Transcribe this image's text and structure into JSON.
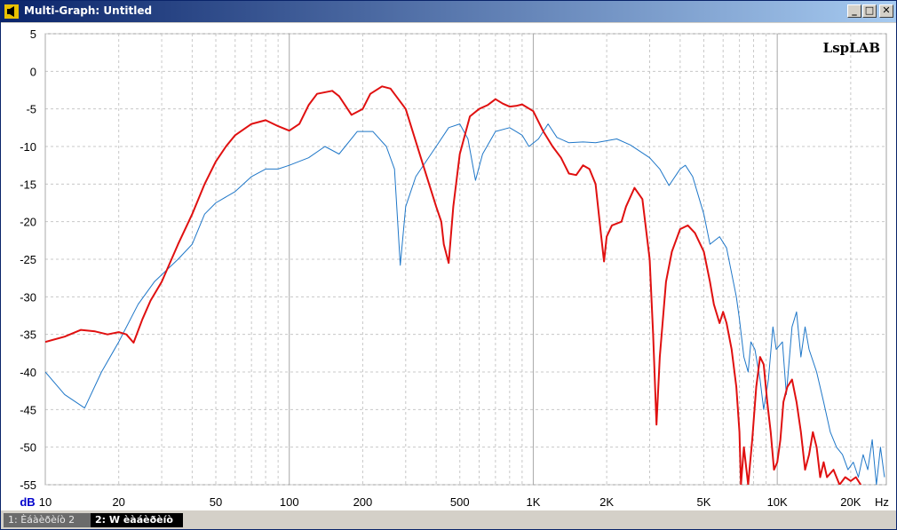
{
  "window": {
    "title": "Multi-Graph: Untitled",
    "buttons": {
      "minimize": "_",
      "maximize": "□",
      "close": "✕"
    }
  },
  "brand": "LspLAB",
  "tabs": [
    {
      "label": "1: Èáàèðèíò 2",
      "active": false
    },
    {
      "label": "2: W èàáèðèíò",
      "active": true
    }
  ],
  "colors": {
    "series1": "#1f77c8",
    "series2": "#e01010",
    "grid": "#c8c8c8",
    "axis_text": "#000000",
    "unit_text": "#0000cc"
  },
  "chart_data": {
    "type": "line",
    "xscale": "log",
    "xlim": [
      10,
      28000
    ],
    "ylim": [
      -55,
      5
    ],
    "ylabel": "dB",
    "xunit": "Hz",
    "x_ticks": [
      {
        "value": 10,
        "label": "10"
      },
      {
        "value": 20,
        "label": "20"
      },
      {
        "value": 50,
        "label": "50"
      },
      {
        "value": 100,
        "label": "100"
      },
      {
        "value": 200,
        "label": "200"
      },
      {
        "value": 500,
        "label": "500"
      },
      {
        "value": 1000,
        "label": "1K"
      },
      {
        "value": 2000,
        "label": "2K"
      },
      {
        "value": 5000,
        "label": "5K"
      },
      {
        "value": 10000,
        "label": "10K"
      },
      {
        "value": 20000,
        "label": "20K"
      }
    ],
    "y_ticks": [
      5,
      0,
      -5,
      -10,
      -15,
      -20,
      -25,
      -30,
      -35,
      -40,
      -45,
      -50,
      -55
    ],
    "grid": true,
    "series": [
      {
        "color_key": "series1",
        "points": [
          [
            10,
            -40
          ],
          [
            12,
            -43
          ],
          [
            14.5,
            -44.8
          ],
          [
            17,
            -40
          ],
          [
            20,
            -36
          ],
          [
            24,
            -31
          ],
          [
            28,
            -28
          ],
          [
            35,
            -25
          ],
          [
            40,
            -23
          ],
          [
            45,
            -19
          ],
          [
            50,
            -17.5
          ],
          [
            60,
            -16
          ],
          [
            70,
            -14
          ],
          [
            80,
            -13
          ],
          [
            90,
            -13
          ],
          [
            100,
            -12.5
          ],
          [
            120,
            -11.5
          ],
          [
            140,
            -10
          ],
          [
            160,
            -11
          ],
          [
            190,
            -8
          ],
          [
            220,
            -8
          ],
          [
            250,
            -10
          ],
          [
            270,
            -13
          ],
          [
            285,
            -25.8
          ],
          [
            300,
            -18
          ],
          [
            330,
            -14
          ],
          [
            400,
            -10
          ],
          [
            450,
            -7.5
          ],
          [
            500,
            -7
          ],
          [
            540,
            -9
          ],
          [
            580,
            -14.5
          ],
          [
            620,
            -11
          ],
          [
            700,
            -8
          ],
          [
            800,
            -7.5
          ],
          [
            850,
            -8
          ],
          [
            900,
            -8.5
          ],
          [
            960,
            -10
          ],
          [
            1050,
            -9
          ],
          [
            1150,
            -7
          ],
          [
            1250,
            -8.8
          ],
          [
            1400,
            -9.5
          ],
          [
            1600,
            -9.4
          ],
          [
            1800,
            -9.5
          ],
          [
            2200,
            -9
          ],
          [
            2500,
            -9.8
          ],
          [
            3000,
            -11.5
          ],
          [
            3300,
            -13
          ],
          [
            3600,
            -15.2
          ],
          [
            4000,
            -13
          ],
          [
            4200,
            -12.5
          ],
          [
            4500,
            -14
          ],
          [
            5000,
            -19
          ],
          [
            5300,
            -23
          ],
          [
            5800,
            -22
          ],
          [
            6200,
            -23.5
          ],
          [
            6800,
            -30
          ],
          [
            7000,
            -33
          ],
          [
            7300,
            -38
          ],
          [
            7600,
            -40
          ],
          [
            7800,
            -36
          ],
          [
            8100,
            -37
          ],
          [
            8500,
            -41
          ],
          [
            8800,
            -45
          ],
          [
            9200,
            -41
          ],
          [
            9600,
            -34
          ],
          [
            9900,
            -37
          ],
          [
            10500,
            -36
          ],
          [
            10900,
            -43
          ],
          [
            11500,
            -34
          ],
          [
            12000,
            -32
          ],
          [
            12500,
            -38
          ],
          [
            13000,
            -34
          ],
          [
            13500,
            -37
          ],
          [
            14500,
            -40
          ],
          [
            15500,
            -44
          ],
          [
            16500,
            -48
          ],
          [
            17500,
            -50
          ],
          [
            18500,
            -51
          ],
          [
            19500,
            -53
          ],
          [
            20500,
            -52
          ],
          [
            21500,
            -54
          ],
          [
            22500,
            -51
          ],
          [
            23500,
            -53
          ],
          [
            24500,
            -49
          ],
          [
            25500,
            -55
          ],
          [
            26500,
            -50
          ],
          [
            27500,
            -54
          ]
        ]
      },
      {
        "color_key": "series2",
        "points": [
          [
            10,
            -36
          ],
          [
            12,
            -35.3
          ],
          [
            14,
            -34.4
          ],
          [
            16,
            -34.6
          ],
          [
            18,
            -35
          ],
          [
            20,
            -34.7
          ],
          [
            21.5,
            -35
          ],
          [
            23,
            -36.1
          ],
          [
            25,
            -33
          ],
          [
            27,
            -30.5
          ],
          [
            30,
            -28
          ],
          [
            35,
            -23
          ],
          [
            40,
            -19
          ],
          [
            45,
            -15
          ],
          [
            50,
            -12
          ],
          [
            55,
            -10
          ],
          [
            60,
            -8.5
          ],
          [
            70,
            -7
          ],
          [
            80,
            -6.5
          ],
          [
            90,
            -7.3
          ],
          [
            100,
            -7.9
          ],
          [
            110,
            -7
          ],
          [
            120,
            -4.5
          ],
          [
            130,
            -3
          ],
          [
            150,
            -2.6
          ],
          [
            160,
            -3.3
          ],
          [
            180,
            -5.8
          ],
          [
            200,
            -5
          ],
          [
            215,
            -3
          ],
          [
            240,
            -2
          ],
          [
            260,
            -2.3
          ],
          [
            300,
            -5
          ],
          [
            350,
            -12
          ],
          [
            400,
            -18
          ],
          [
            420,
            -20
          ],
          [
            430,
            -23
          ],
          [
            450,
            -25.5
          ],
          [
            470,
            -18
          ],
          [
            500,
            -11
          ],
          [
            550,
            -6
          ],
          [
            600,
            -5
          ],
          [
            650,
            -4.5
          ],
          [
            700,
            -3.7
          ],
          [
            750,
            -4.3
          ],
          [
            800,
            -4.7
          ],
          [
            850,
            -4.6
          ],
          [
            900,
            -4.4
          ],
          [
            1000,
            -5.3
          ],
          [
            1100,
            -8
          ],
          [
            1200,
            -10
          ],
          [
            1300,
            -11.5
          ],
          [
            1400,
            -13.6
          ],
          [
            1500,
            -13.8
          ],
          [
            1600,
            -12.5
          ],
          [
            1700,
            -13
          ],
          [
            1800,
            -15
          ],
          [
            1900,
            -22
          ],
          [
            1950,
            -25.3
          ],
          [
            2000,
            -22
          ],
          [
            2100,
            -20.5
          ],
          [
            2300,
            -20
          ],
          [
            2400,
            -18
          ],
          [
            2600,
            -15.5
          ],
          [
            2800,
            -17
          ],
          [
            3000,
            -25
          ],
          [
            3100,
            -35
          ],
          [
            3200,
            -47
          ],
          [
            3300,
            -38
          ],
          [
            3500,
            -28
          ],
          [
            3700,
            -24
          ],
          [
            4000,
            -21
          ],
          [
            4300,
            -20.5
          ],
          [
            4600,
            -21.5
          ],
          [
            5000,
            -24
          ],
          [
            5300,
            -28
          ],
          [
            5500,
            -31
          ],
          [
            5800,
            -33.5
          ],
          [
            6000,
            -32
          ],
          [
            6200,
            -33.5
          ],
          [
            6500,
            -37
          ],
          [
            6800,
            -42
          ],
          [
            7000,
            -48
          ],
          [
            7100,
            -55
          ],
          [
            7300,
            -50
          ],
          [
            7600,
            -55
          ],
          [
            7900,
            -49
          ],
          [
            8200,
            -42
          ],
          [
            8500,
            -38
          ],
          [
            8800,
            -39
          ],
          [
            9100,
            -44
          ],
          [
            9400,
            -48
          ],
          [
            9700,
            -53
          ],
          [
            10000,
            -52
          ],
          [
            10300,
            -49
          ],
          [
            10600,
            -44
          ],
          [
            11000,
            -42
          ],
          [
            11500,
            -41
          ],
          [
            12000,
            -44
          ],
          [
            12500,
            -48
          ],
          [
            13000,
            -53
          ],
          [
            13500,
            -51
          ],
          [
            14000,
            -48
          ],
          [
            14500,
            -50
          ],
          [
            15000,
            -54
          ],
          [
            15500,
            -52
          ],
          [
            16000,
            -54
          ],
          [
            17000,
            -53
          ],
          [
            18000,
            -55
          ],
          [
            19000,
            -54
          ],
          [
            20000,
            -54.5
          ],
          [
            21000,
            -54
          ],
          [
            22000,
            -55
          ]
        ]
      }
    ]
  }
}
